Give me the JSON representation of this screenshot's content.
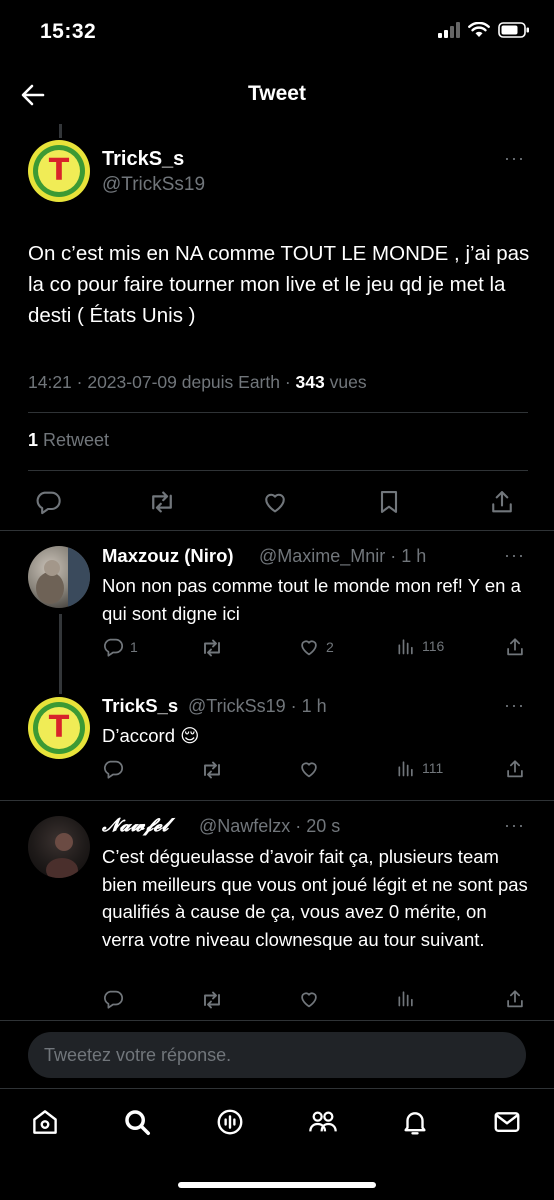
{
  "status": {
    "time": "15:32"
  },
  "header": {
    "title": "Tweet"
  },
  "main_tweet": {
    "name": "TrickS_s",
    "handle": "@TrickSs19",
    "text": "On c’est mis en NA comme TOUT LE MONDE , j’ai pas la co pour faire tourner mon live et le jeu qd je met la desti ( États Unis )",
    "meta_prefix": "14:21 · 2023-07-09 depuis Earth · ",
    "views_count": "343",
    "views_label": " vues",
    "retweet_count": "1",
    "retweet_label": " Retweet",
    "more": "···"
  },
  "replies": [
    {
      "name": "Maxzouz (Niro)",
      "handle": "@Maxime_Mnir · 1 h",
      "text": "Non non pas comme tout le monde mon ref! Y en a qui sont digne ici",
      "reply_count": "1",
      "like_count": "2",
      "views": "116",
      "more": "···"
    },
    {
      "name": "TrickS_s",
      "handle": "@TrickSs19 · 1 h",
      "text": "D’accord 😌",
      "views": "111",
      "more": "···"
    },
    {
      "name": "𝓝𝓪𝔀𝓯𝓮𝓵",
      "handle": "@Nawfelzx · 20 s",
      "text": "C’est dégueulasse d’avoir fait ça, plusieurs team bien meilleurs que vous ont joué légit et ne sont pas qualifiés à cause de ça, vous avez 0 mérite, on verra votre niveau clownesque au tour suivant.",
      "more": "···"
    }
  ],
  "compose": {
    "placeholder": "Tweetez votre réponse."
  },
  "colors": {
    "accent": "#1d9bf0",
    "muted": "#71767b",
    "background": "#000000",
    "divider": "#2f3336"
  },
  "icons": {
    "tabbar": [
      "home-icon",
      "search-icon",
      "spaces-icon",
      "communities-icon",
      "notifications-icon",
      "messages-icon"
    ],
    "actions": [
      "reply-icon",
      "retweet-icon",
      "like-icon",
      "bookmark-icon",
      "share-icon",
      "views-icon"
    ]
  }
}
